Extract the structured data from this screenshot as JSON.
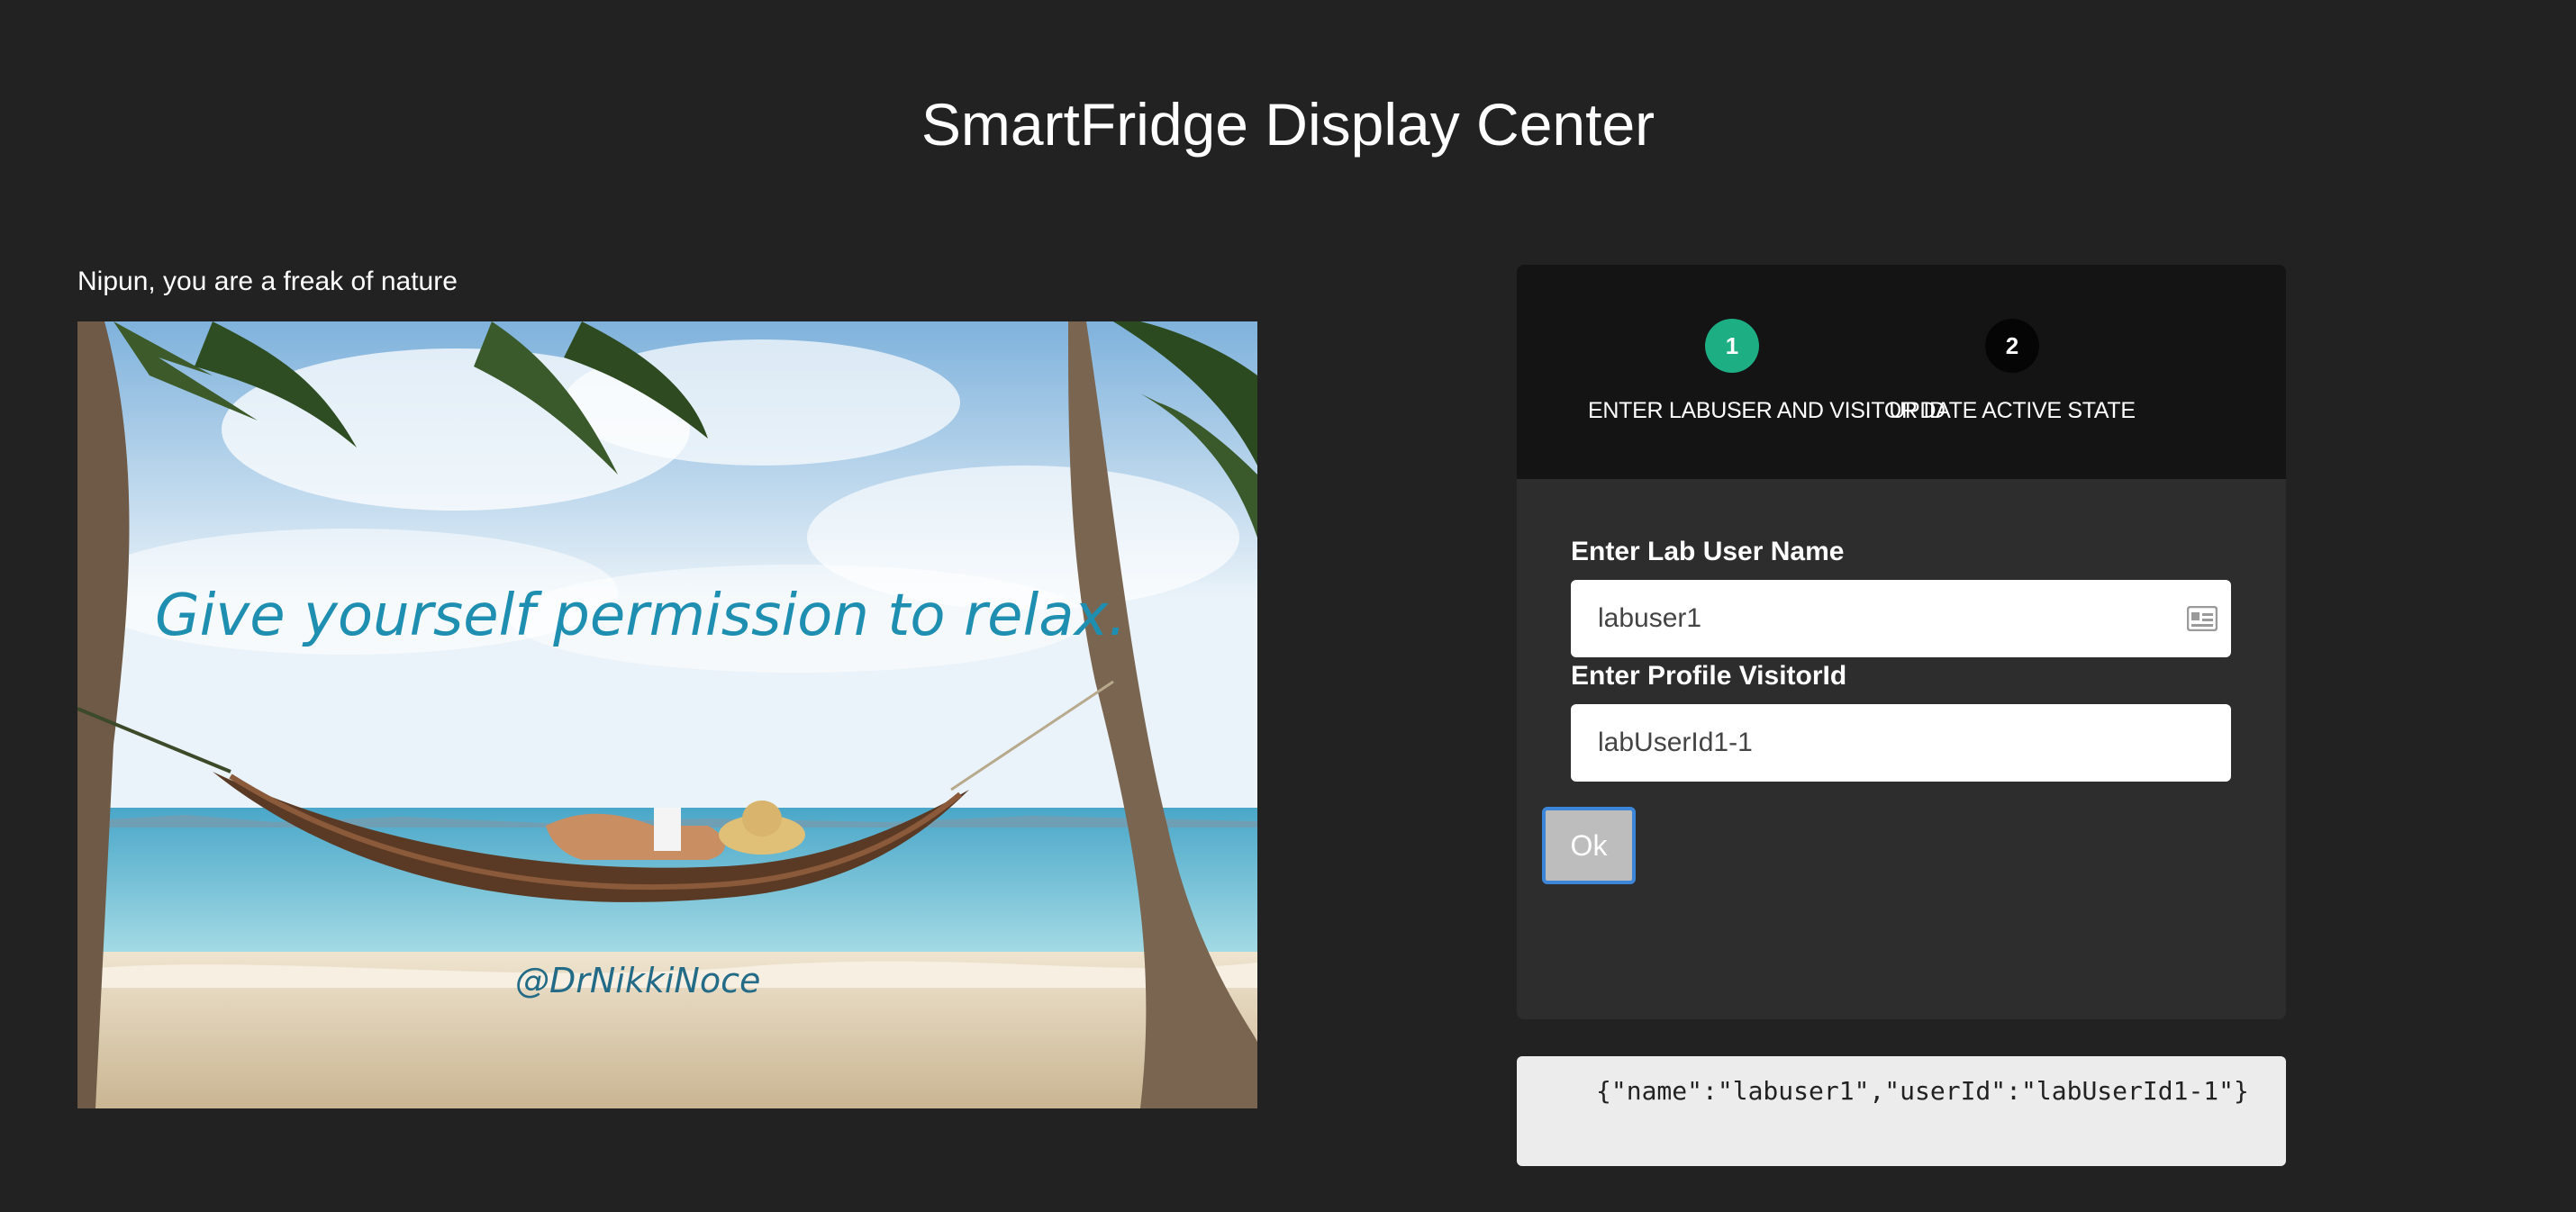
{
  "page": {
    "title": "SmartFridge Display Center"
  },
  "greeting": {
    "text": "Nipun, you are a freak of nature"
  },
  "photo": {
    "caption": "Give yourself permission to relax.",
    "credit": "@DrNikkiNoce"
  },
  "wizard": {
    "steps": [
      {
        "number": "1",
        "label": "ENTER LABUSER AND VISITOR ID",
        "state": "active"
      },
      {
        "number": "2",
        "label": "UPDATE ACTIVE STATE",
        "state": "inactive"
      }
    ],
    "username_label": "Enter Lab User Name",
    "username_value": "labuser1",
    "visitor_label": "Enter Profile VisitorId",
    "visitor_value": "labUserId1-1",
    "ok_label": "Ok",
    "active_color": "#1dae84"
  },
  "output": {
    "json_text": "{\"name\":\"labuser1\",\"userId\":\"labUserId1-1\"}"
  }
}
